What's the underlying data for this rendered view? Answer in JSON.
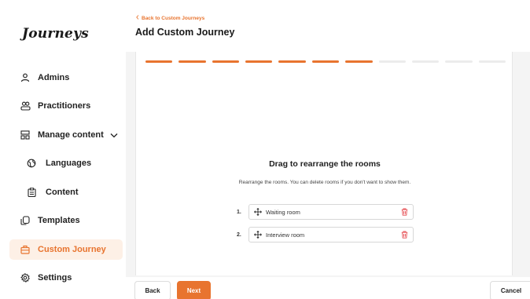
{
  "app": {
    "logo": "Journeys"
  },
  "sidebar": {
    "items": [
      {
        "label": "Admins",
        "icon": "user-icon"
      },
      {
        "label": "Practitioners",
        "icon": "users-icon"
      },
      {
        "label": "Manage content",
        "icon": "layout-icon"
      },
      {
        "label": "Languages",
        "icon": "globe-icon"
      },
      {
        "label": "Content",
        "icon": "clipboard-icon"
      },
      {
        "label": "Templates",
        "icon": "copy-icon"
      },
      {
        "label": "Custom Journey",
        "icon": "briefcase-icon",
        "active": true
      },
      {
        "label": "Settings",
        "icon": "gear-icon"
      }
    ]
  },
  "header": {
    "back_link": "Back to Custom Journeys",
    "title": "Add Custom Journey"
  },
  "progress": {
    "completed_steps": 7,
    "total_steps": 11
  },
  "main": {
    "heading": "Drag to rearrange the rooms",
    "description": "Rearrange the rooms. You can delete rooms if you don't want to show them.",
    "rooms": [
      {
        "number": "1.",
        "name": "Waiting room"
      },
      {
        "number": "2.",
        "name": "Interview room"
      }
    ]
  },
  "footer": {
    "back_label": "Back",
    "next_label": "Next",
    "cancel_label": "Cancel"
  },
  "colors": {
    "accent": "#e8742f",
    "accent_light": "#fdf0e6",
    "delete": "#e5484d"
  }
}
